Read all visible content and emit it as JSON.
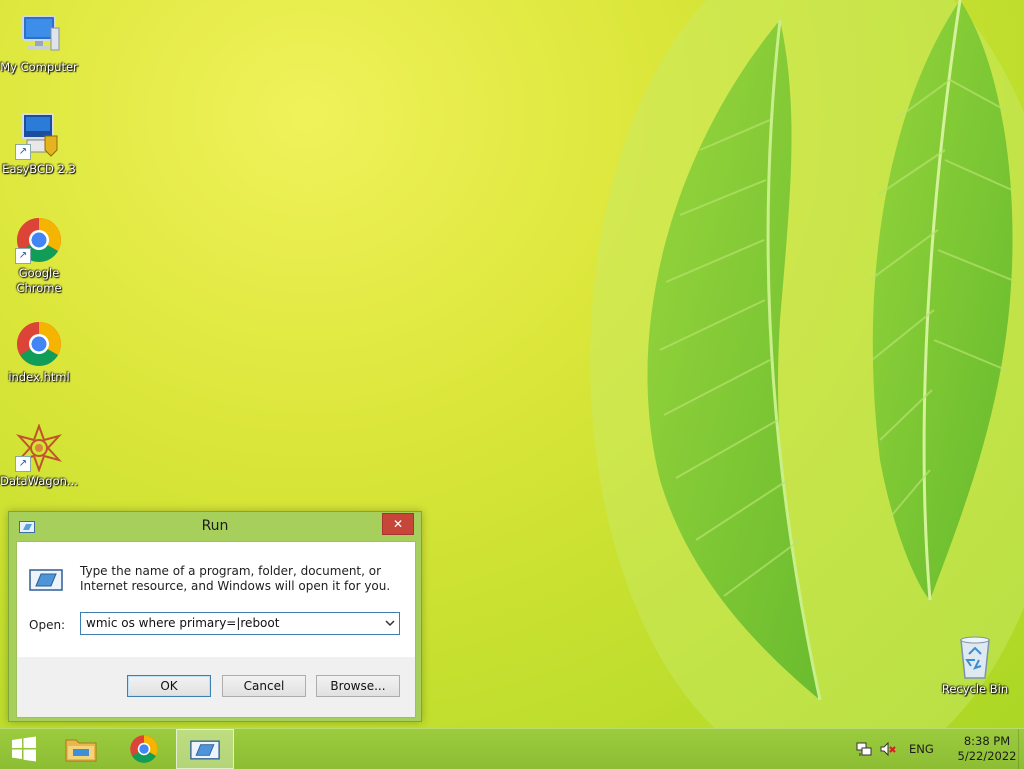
{
  "desktop": {
    "icons": [
      {
        "label": "My Computer",
        "icon": "computer-icon"
      },
      {
        "label": "EasyBCD 2.3",
        "icon": "easybcd-icon"
      },
      {
        "label": "Google Chrome",
        "icon": "chrome-icon"
      },
      {
        "label": "index.html",
        "icon": "chrome-icon"
      },
      {
        "label": "DataWagon...",
        "icon": "datawagon-icon"
      },
      {
        "label": "Recycle Bin",
        "icon": "recycle-bin-icon"
      }
    ]
  },
  "run_dialog": {
    "title": "Run",
    "description": "Type the name of a program, folder, document, or Internet resource, and Windows will open it for you.",
    "open_label": "Open:",
    "open_value": "wmic os where primary=|reboot",
    "ok_label": "OK",
    "cancel_label": "Cancel",
    "browse_label": "Browse...",
    "close_glyph": "✕"
  },
  "taskbar": {
    "items": [
      {
        "name": "start-button",
        "icon": "windows-logo-icon"
      },
      {
        "name": "file-explorer",
        "icon": "folder-icon"
      },
      {
        "name": "google-chrome",
        "icon": "chrome-icon"
      },
      {
        "name": "run",
        "icon": "run-icon",
        "active": true
      }
    ],
    "tray": {
      "language": "ENG",
      "time": "8:38 PM",
      "date": "5/22/2022"
    }
  },
  "colors": {
    "accent": "#a6cf5b",
    "taskbar": "#94c43a",
    "close_button": "#c7463a"
  }
}
